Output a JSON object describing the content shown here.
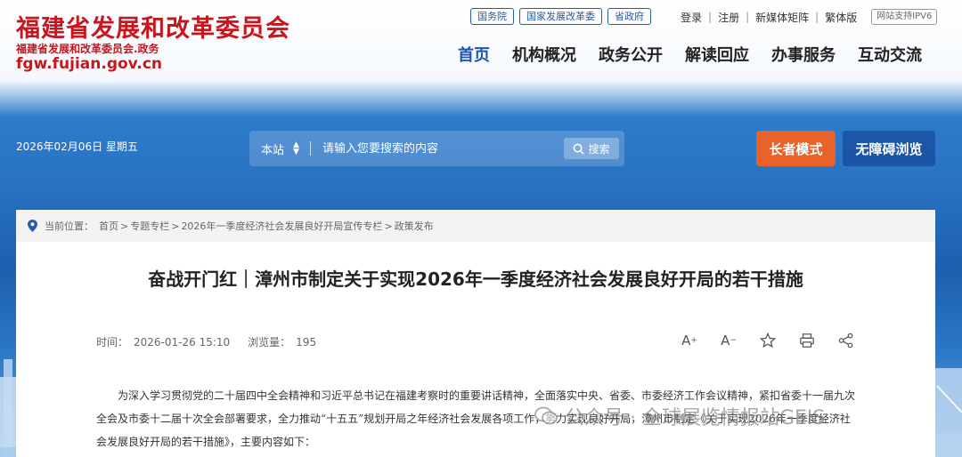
{
  "header": {
    "logo_title": "福建省发展和改革委员会",
    "logo_sub": "福建省发展和改革委员会.政务",
    "logo_domain": "fgw.fujian.gov.cn",
    "top_links": [
      "国务院",
      "国家发展改革委",
      "省政府"
    ],
    "util_links": [
      "登录",
      "注册",
      "新媒体矩阵",
      "繁体版"
    ],
    "ipv6": "网站支持IPV6",
    "nav": [
      "首页",
      "机构概况",
      "政务公开",
      "解读回应",
      "办事服务",
      "互动交流"
    ]
  },
  "banner": {
    "date": "2026年02月06日 星期五",
    "search_scope": "本站",
    "search_placeholder": "请输入您要搜索的内容",
    "search_button": "搜索",
    "elder_mode": "长者模式",
    "accessible": "无障碍浏览"
  },
  "breadcrumb": {
    "label": "当前位置：",
    "items": [
      "首页",
      "专题专栏",
      "2026年一季度经济社会发展良好开局宣传专栏",
      "政策发布"
    ]
  },
  "article": {
    "title": "奋战开门红｜漳州市制定关于实现2026年一季度经济社会发展良好开局的若干措施",
    "time_label": "时间：",
    "time": "2026-01-26 15:10",
    "views_label": "浏览量：",
    "views": "195",
    "body": "为深入学习贯彻党的二十届四中全会精神和习近平总书记在福建考察时的重要讲话精神，全面落实中央、省委、市委经济工作会议精神，紧扣省委十一届九次全会及市委十二届十次全会部署要求，全力推动“十五五”规划开局之年经济社会发展各项工作，努力实现良好开局，漳州市制定《关于实现2026年一季度经济社会发展良好开局的若干措施》，主要内容如下："
  },
  "watermark": "公众号 · 全球展览情报站GEIS",
  "colors": {
    "brand_red": "#c9151e",
    "nav_active": "#1a56b0",
    "elder_btn": "#e8622a"
  }
}
